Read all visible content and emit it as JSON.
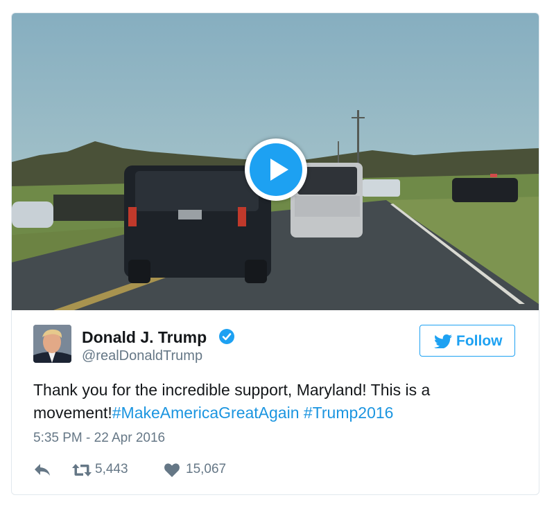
{
  "tweet": {
    "author_name": "Donald J. Trump",
    "author_handle": "@realDonaldTrump",
    "follow_label": "Follow",
    "text": "Thank you for the incredible support, Maryland! This is a movement!",
    "hashtags": [
      "#MakeAmericaGreatAgain",
      "#Trump2016"
    ],
    "timestamp": "5:35 PM - 22 Apr 2016",
    "retweet_count": "5,443",
    "like_count": "15,067"
  },
  "icons": {
    "play": "play-icon",
    "verified": "verified-badge-icon",
    "follow": "twitter-bird-icon",
    "reply": "reply-icon",
    "retweet": "retweet-icon",
    "like": "heart-icon"
  },
  "colors": {
    "accent": "#1da1f2",
    "hashtag": "#1b95e0",
    "muted": "#657786",
    "text": "#14171a"
  }
}
